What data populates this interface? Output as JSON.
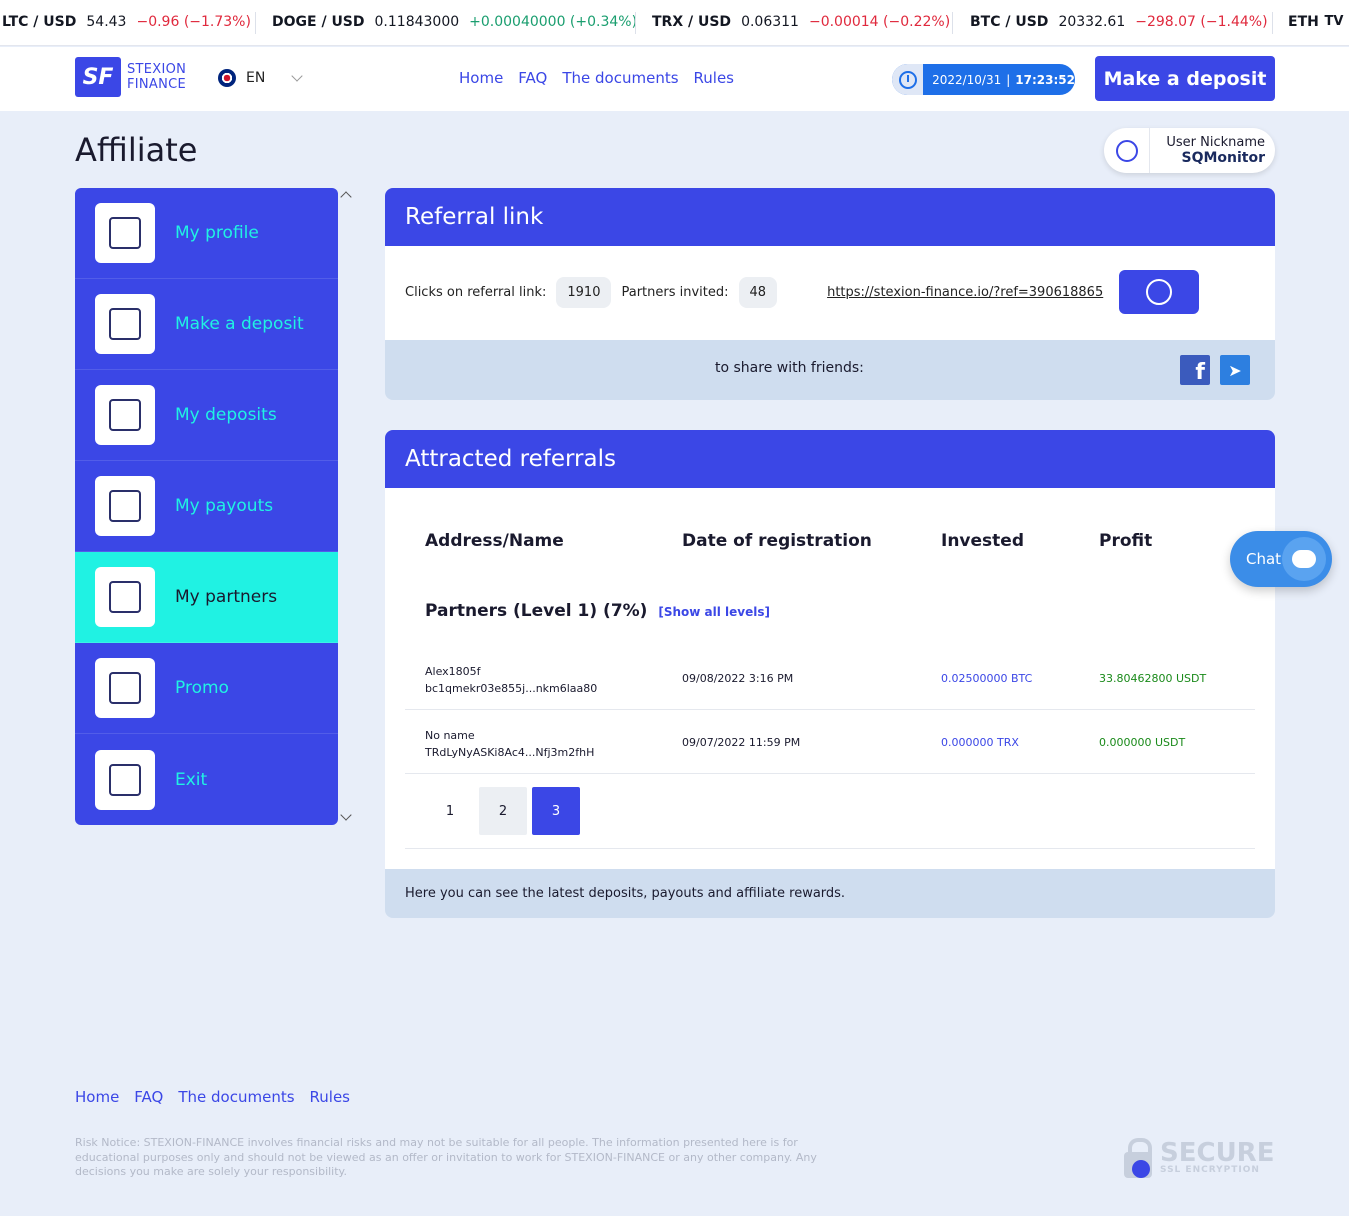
{
  "ticker": [
    {
      "symbol": "LTC / USD",
      "price": "54.43",
      "change": "−0.96 (−1.73%)",
      "direction": "down"
    },
    {
      "symbol": "DOGE / USD",
      "price": "0.11843000",
      "change": "+0.00040000 (+0.34%)",
      "direction": "up"
    },
    {
      "symbol": "TRX / USD",
      "price": "0.06311",
      "change": "−0.00014 (−0.22%)",
      "direction": "down"
    },
    {
      "symbol": "BTC / USD",
      "price": "20332.61",
      "change": "−298.07 (−1.44%)",
      "direction": "down"
    },
    {
      "symbol": "ETH",
      "price": "",
      "change": "",
      "direction": ""
    }
  ],
  "ticker_logo": "TV",
  "header": {
    "logo_mark": "SF",
    "logo_line1": "STEXION",
    "logo_line2": "FINANCE",
    "language": "EN",
    "nav": [
      "Home",
      "FAQ",
      "The documents",
      "Rules"
    ],
    "date": "2022/10/31",
    "time": "17:23:52",
    "deposit_button": "Make a deposit"
  },
  "page_title": "Affiliate",
  "user": {
    "label": "User Nickname",
    "name": "SQMonitor"
  },
  "sidebar": [
    {
      "label": "My profile",
      "icon": "chart-profile-icon",
      "active": false
    },
    {
      "label": "Make a deposit",
      "icon": "deposit-icon",
      "active": false
    },
    {
      "label": "My deposits",
      "icon": "deposits-icon",
      "active": false
    },
    {
      "label": "My payouts",
      "icon": "payouts-icon",
      "active": false
    },
    {
      "label": "My partners",
      "icon": "handshake-icon",
      "active": true
    },
    {
      "label": "Promo",
      "icon": "promo-icon",
      "active": false
    },
    {
      "label": "Exit",
      "icon": "exit-icon",
      "active": false
    }
  ],
  "referral": {
    "title": "Referral link",
    "clicks_label": "Clicks on referral link:",
    "clicks_value": "1910",
    "partners_label": "Partners invited:",
    "partners_value": "48",
    "link": "https://stexion-finance.io/?ref=390618865",
    "share_text": "to share with friends:"
  },
  "referrals": {
    "title": "Attracted referrals",
    "columns": [
      "Address/Name",
      "Date of registration",
      "Invested",
      "Profit"
    ],
    "level_title": "Partners (Level 1) (7%)",
    "show_all": "[Show all levels]",
    "rows": [
      {
        "name": "Alex1805f",
        "address": "bc1qmekr03e855j...nkm6laa80",
        "date": "09/08/2022 3:16 PM",
        "invested": "0.02500000 BTC",
        "profit": "33.80462800 USDT"
      },
      {
        "name": "No name",
        "address": "TRdLyNyASKi8Ac4...Nfj3m2fhH",
        "date": "09/07/2022 11:59 PM",
        "invested": "0.000000 TRX",
        "profit": "0.000000 USDT"
      }
    ],
    "pages": [
      "1",
      "2",
      "3"
    ],
    "current_page": "3",
    "info": "Here you can see the latest deposits, payouts and affiliate rewards."
  },
  "chat": {
    "label": "Chat"
  },
  "footer": {
    "nav": [
      "Home",
      "FAQ",
      "The documents",
      "Rules"
    ],
    "risk": "Risk Notice: STEXION-FINANCE involves financial risks and may not be suitable for all people. The information presented here is for educational purposes only and should not be viewed as an offer or invitation to work for STEXION-FINANCE or any other company. Any decisions you make are solely your responsibility.",
    "ssl_title": "SECURE",
    "ssl_sub": "SSL ENCRYPTION"
  },
  "colors": {
    "primary": "#3b47e6",
    "accent": "#20f2e3",
    "down": "#e0293d",
    "up": "#1a9e6f"
  }
}
